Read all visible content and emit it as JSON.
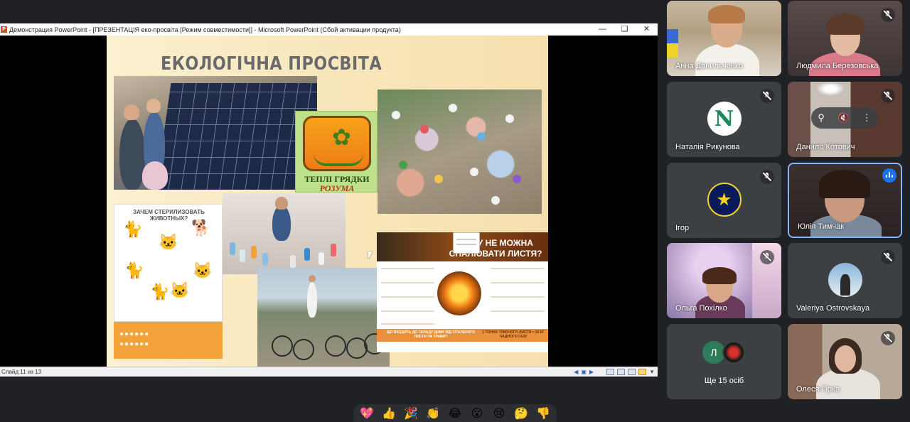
{
  "powerpoint": {
    "window_title": "Демонстрация PowerPoint - [ПРЕЗЕНТАЦІЯ  еко-просвіта [Режим совместимости]] - Microsoft PowerPoint (Сбой активации продукта)",
    "status_text": "Слайд 11 из 13",
    "icon_name": "powerpoint-icon",
    "controls": [
      "minimize-icon",
      "restore-icon",
      "close-icon"
    ],
    "slide": {
      "title": "ЕКОЛОГІЧНА ПРОСВІТА",
      "logo_line1": "ТЕПЛІ ГРЯДКИ",
      "logo_line2": "РОЗУМА",
      "cats_title": "ЗАЧЕМ СТЕРИЛИЗОВАТЬ ЖИВОТНЫХ?",
      "leaves_title": "ЧОМУ НЕ МОЖНА СПАЛЮВАТИ ЛИСТЯ?",
      "leaves_band_left": "ЩО ВХОДИТЬ ДО СКЛАДУ ДИМУ ВІД СПАЛЕНОГО ЛИСТЯ ЧИ ТРАВИ?",
      "leaves_band_right": "1 ТОННА ТЛІЮЧОГО ЛИСТЯ = 30 КГ ЧАДНОГО ГАЗУ"
    }
  },
  "participants": [
    {
      "name": "Анна Данильченко",
      "muted": false
    },
    {
      "name": "Людмила Березовська",
      "muted": true
    },
    {
      "name": "Наталія Рикунова",
      "muted": true,
      "avatar": "N"
    },
    {
      "name": "Данило Котович",
      "muted": true
    },
    {
      "name": "Ігор",
      "muted": true
    },
    {
      "name": "Юлія Тимчак",
      "muted": false,
      "speaking": true
    },
    {
      "name": "Ольга Похілко",
      "muted": true
    },
    {
      "name": "Valeriya Ostrovskaya",
      "muted": true
    },
    {
      "name": "Ще 15 осіб",
      "avatar": "Л"
    },
    {
      "name": "Олеся Гірка",
      "muted": true
    }
  ],
  "reactions": [
    "💖",
    "👍",
    "🎉",
    "👏",
    "😂",
    "😮",
    "😢",
    "🤔",
    "👎"
  ],
  "colors": {
    "meet_bg": "#202124",
    "tile_bg": "#3c4043",
    "speaking_border": "#8ab4f8",
    "speaking_indicator": "#1a73e8"
  }
}
